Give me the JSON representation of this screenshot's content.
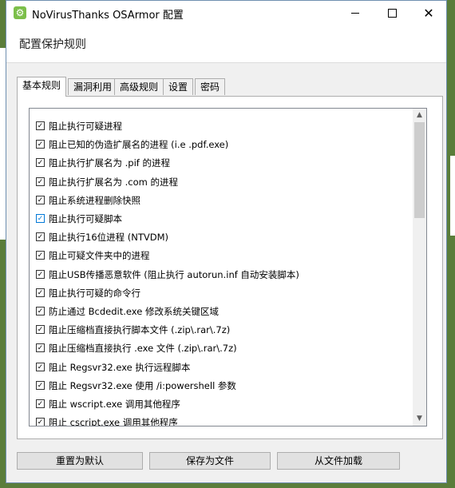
{
  "window": {
    "title": "NoVirusThanks OSArmor 配置"
  },
  "titlebar_buttons": {
    "close": "✕"
  },
  "header": {
    "title": "配置保护规则"
  },
  "tabs": [
    {
      "label": "基本规则"
    },
    {
      "label": "漏洞利用"
    },
    {
      "label": "高级规则"
    },
    {
      "label": "设置"
    },
    {
      "label": "密码"
    }
  ],
  "rules": [
    {
      "label": "阻止执行可疑进程",
      "checked": true
    },
    {
      "label": "阻止已知的伪造扩展名的进程 (i.e .pdf.exe)",
      "checked": true
    },
    {
      "label": "阻止执行扩展名为 .pif 的进程",
      "checked": true
    },
    {
      "label": "阻止执行扩展名为 .com 的进程",
      "checked": true
    },
    {
      "label": "阻止系统进程删除快照",
      "checked": true
    },
    {
      "label": "阻止执行可疑脚本",
      "checked": true
    },
    {
      "label": "阻止执行16位进程 (NTVDM)",
      "checked": true
    },
    {
      "label": "阻止可疑文件夹中的进程",
      "checked": true
    },
    {
      "label": "阻止USB传播恶意软件 (阻止执行 autorun.inf 自动安装脚本)",
      "checked": true
    },
    {
      "label": "阻止执行可疑的命令行",
      "checked": true
    },
    {
      "label": "防止通过 Bcdedit.exe 修改系统关键区域",
      "checked": true
    },
    {
      "label": "阻止压缩档直接执行脚本文件 (.zip\\.rar\\.7z)",
      "checked": true
    },
    {
      "label": "阻止压缩档直接执行 .exe 文件  (.zip\\.rar\\.7z)",
      "checked": true
    },
    {
      "label": "阻止 Regsvr32.exe 执行远程脚本",
      "checked": true
    },
    {
      "label": "阻止 Regsvr32.exe 使用 /i:powershell 参数",
      "checked": true
    },
    {
      "label": "阻止 wscript.exe 调用其他程序",
      "checked": true
    },
    {
      "label": "阻止 cscript.exe 调用其他程序",
      "checked": true
    }
  ],
  "buttons": {
    "reset": "重置为默认",
    "save": "保存为文件",
    "load": "从文件加载"
  },
  "colors": {
    "focus": "#0078d7",
    "app_icon": "#7cbf4a"
  }
}
